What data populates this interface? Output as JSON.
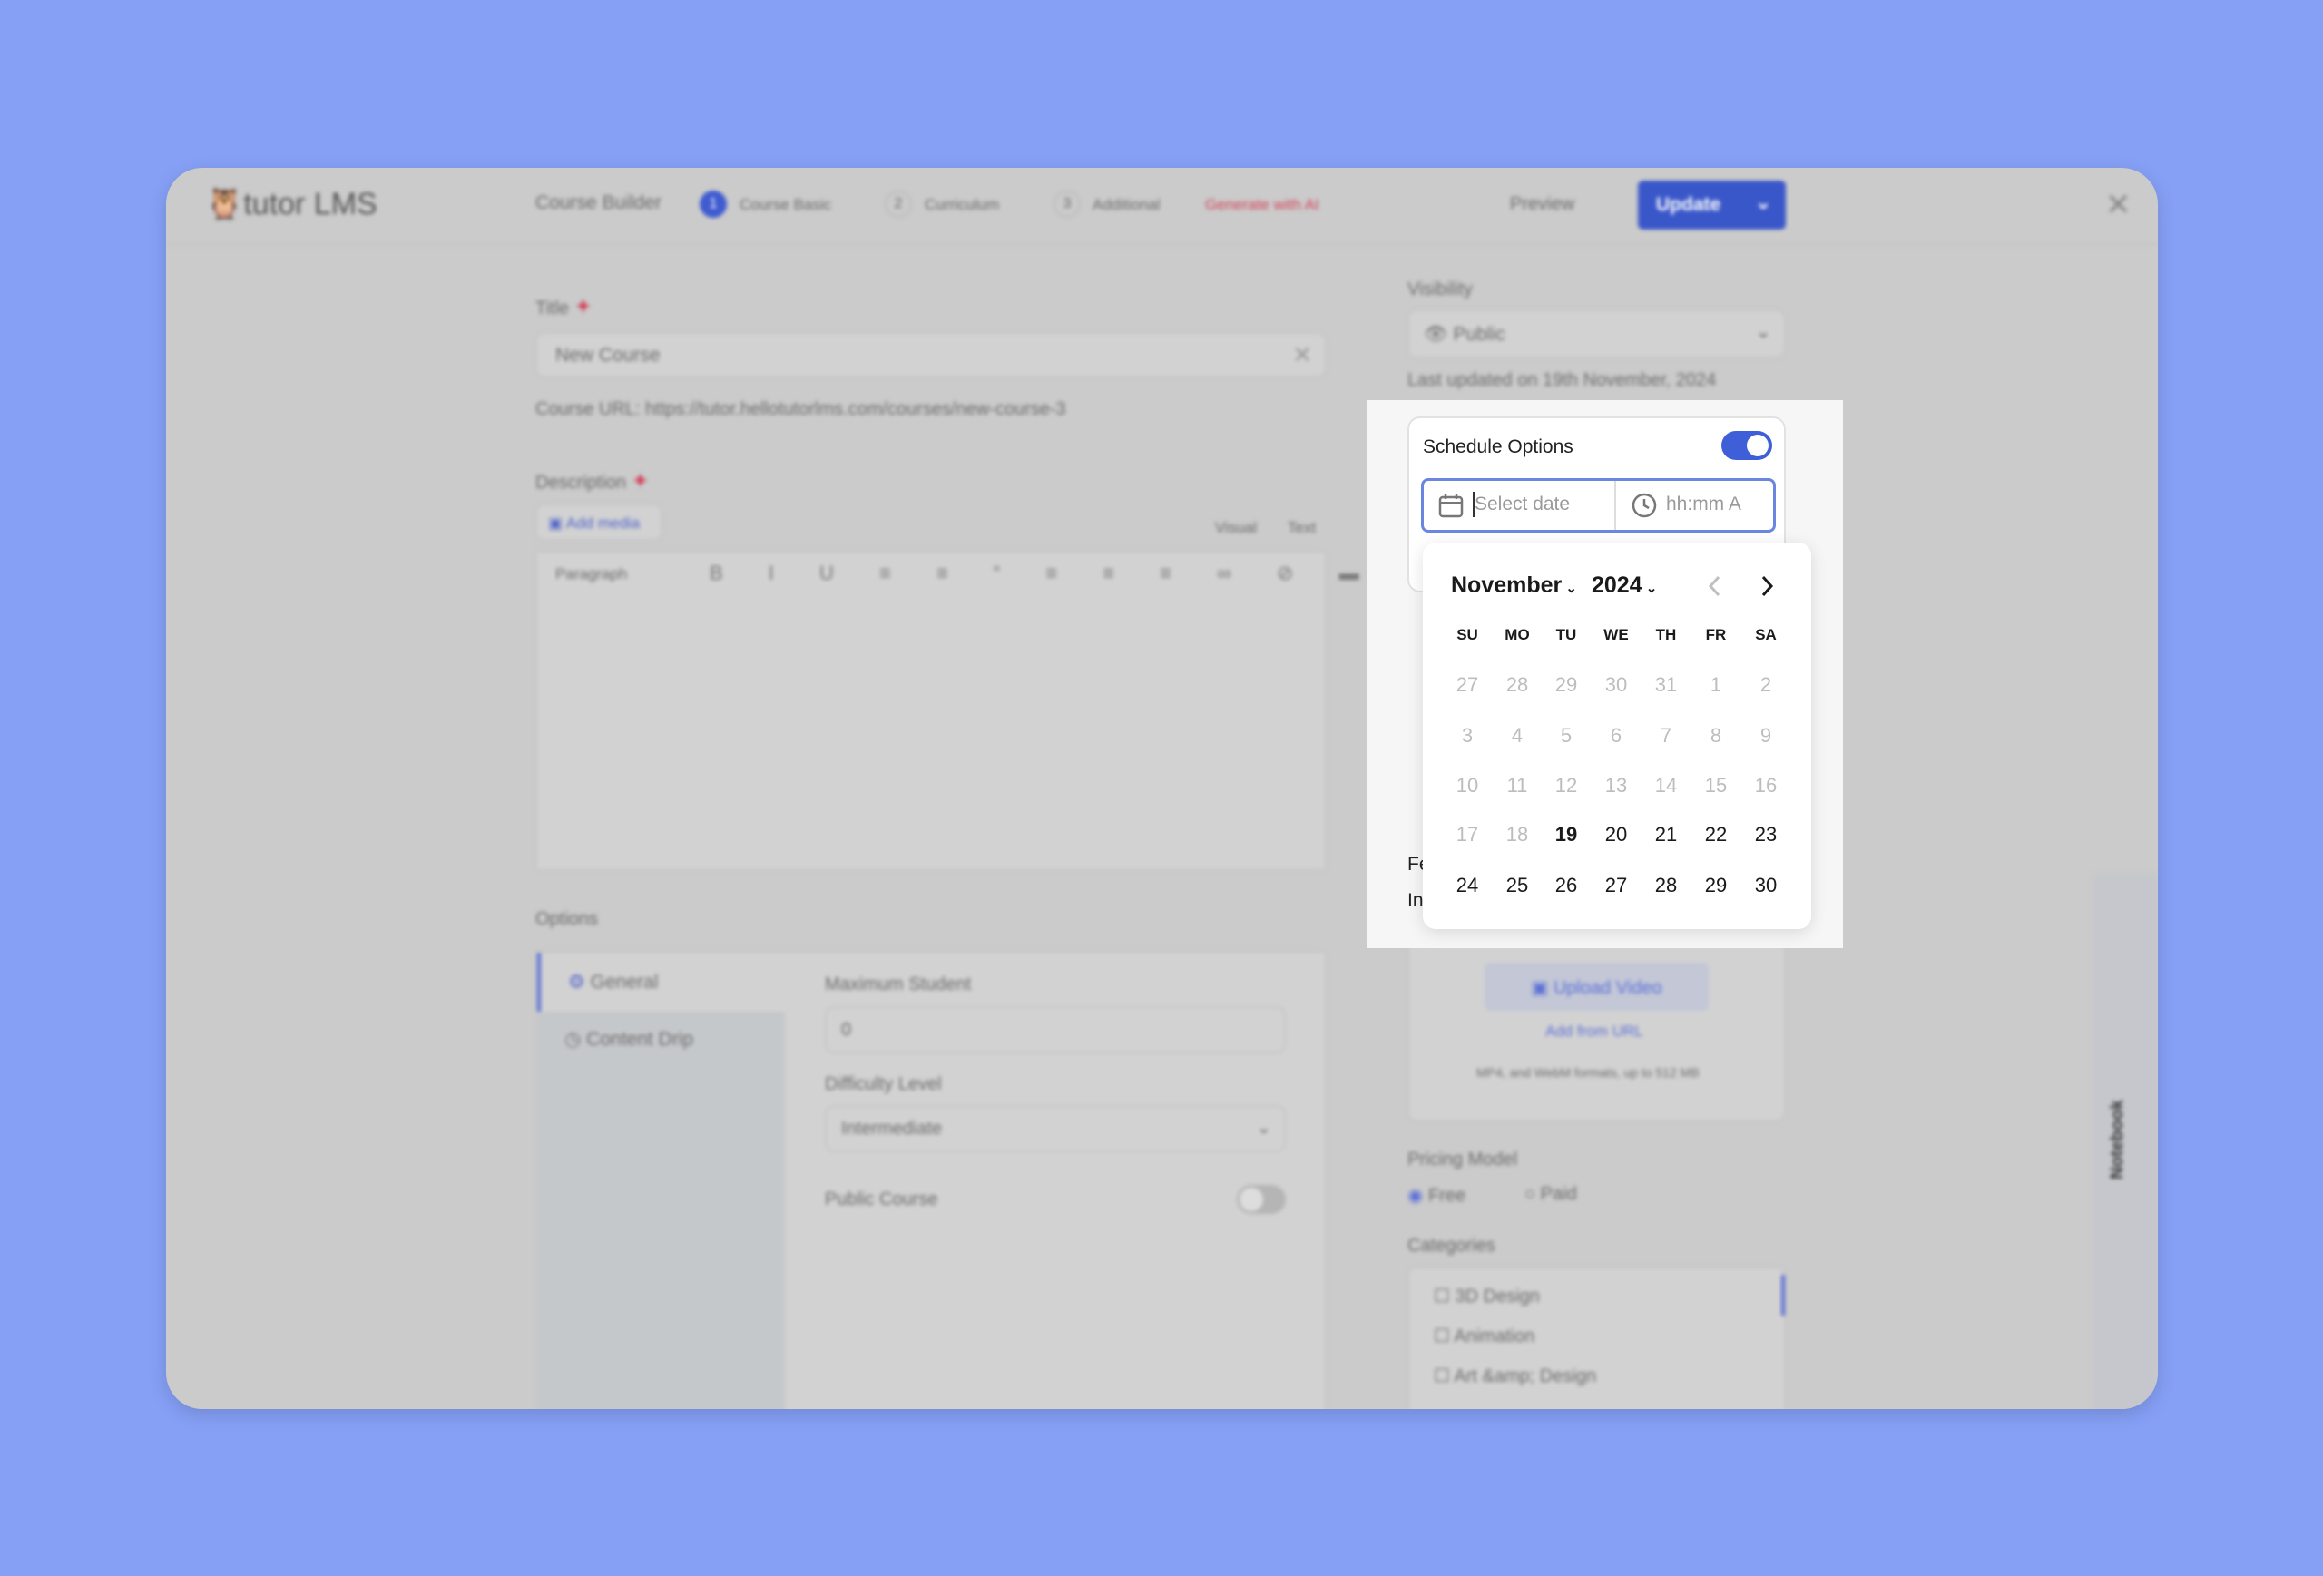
{
  "header": {
    "logo": "tutor LMS",
    "course_builder": "Course Builder",
    "steps": [
      {
        "num": "1",
        "label": "Course Basic"
      },
      {
        "num": "2",
        "label": "Curriculum"
      },
      {
        "num": "3",
        "label": "Additional"
      }
    ],
    "generate_ai": "Generate with AI",
    "preview": "Preview",
    "update": "Update"
  },
  "main": {
    "title_label": "Title",
    "title_value": "New Course",
    "course_url": "Course URL: https://tutor.hellotutorlms.com/courses/new-course-3",
    "description_label": "Description",
    "add_media": "Add media",
    "visual_tab": "Visual",
    "text_tab": "Text",
    "paragraph": "Paragraph",
    "options_label": "Options",
    "tabs": [
      "General",
      "Content Drip"
    ],
    "max_student_label": "Maximum Student",
    "max_student_value": "0",
    "difficulty_label": "Difficulty Level",
    "difficulty_value": "Intermediate",
    "public_course_label": "Public Course"
  },
  "sidebar": {
    "visibility_label": "Visibility",
    "visibility_value": "Public",
    "last_updated": "Last updated on 19th November, 2024",
    "schedule_label": "Schedule Options",
    "schedule_enabled": true,
    "date_placeholder": "Select date",
    "time_placeholder": "hh:mm A",
    "featured_partial": "Fe",
    "intro_partial": "In",
    "upload_video": "Upload Video",
    "add_from_url": "Add from URL",
    "formats": "MP4, and WebM formats, up to 512 MB",
    "pricing_label": "Pricing Model",
    "pricing_options": [
      "Free",
      "Paid"
    ],
    "pricing_selected": "Free",
    "categories_label": "Categories",
    "categories": [
      "3D Design",
      "Animation",
      "Art &amp; Design"
    ],
    "notebook": "Notebook"
  },
  "calendar": {
    "month": "November",
    "year": "2024",
    "weekdays": [
      "SU",
      "MO",
      "TU",
      "WE",
      "TH",
      "FR",
      "SA"
    ],
    "weeks": [
      [
        [
          "27",
          1
        ],
        [
          "28",
          1
        ],
        [
          "29",
          1
        ],
        [
          "30",
          1
        ],
        [
          "31",
          1
        ],
        [
          "1",
          1
        ],
        [
          "2",
          1
        ]
      ],
      [
        [
          "3",
          1
        ],
        [
          "4",
          1
        ],
        [
          "5",
          1
        ],
        [
          "6",
          1
        ],
        [
          "7",
          1
        ],
        [
          "8",
          1
        ],
        [
          "9",
          1
        ]
      ],
      [
        [
          "10",
          1
        ],
        [
          "11",
          1
        ],
        [
          "12",
          1
        ],
        [
          "13",
          1
        ],
        [
          "14",
          1
        ],
        [
          "15",
          1
        ],
        [
          "16",
          1
        ]
      ],
      [
        [
          "17",
          1
        ],
        [
          "18",
          1
        ],
        [
          "19",
          2
        ],
        [
          "20",
          0
        ],
        [
          "21",
          0
        ],
        [
          "22",
          0
        ],
        [
          "23",
          0
        ]
      ],
      [
        [
          "24",
          0
        ],
        [
          "25",
          0
        ],
        [
          "26",
          0
        ],
        [
          "27",
          0
        ],
        [
          "28",
          0
        ],
        [
          "29",
          0
        ],
        [
          "30",
          0
        ]
      ]
    ]
  },
  "colors": {
    "accent": "#3e64de",
    "background": "#86a0f6",
    "ai": "#d2465c"
  }
}
